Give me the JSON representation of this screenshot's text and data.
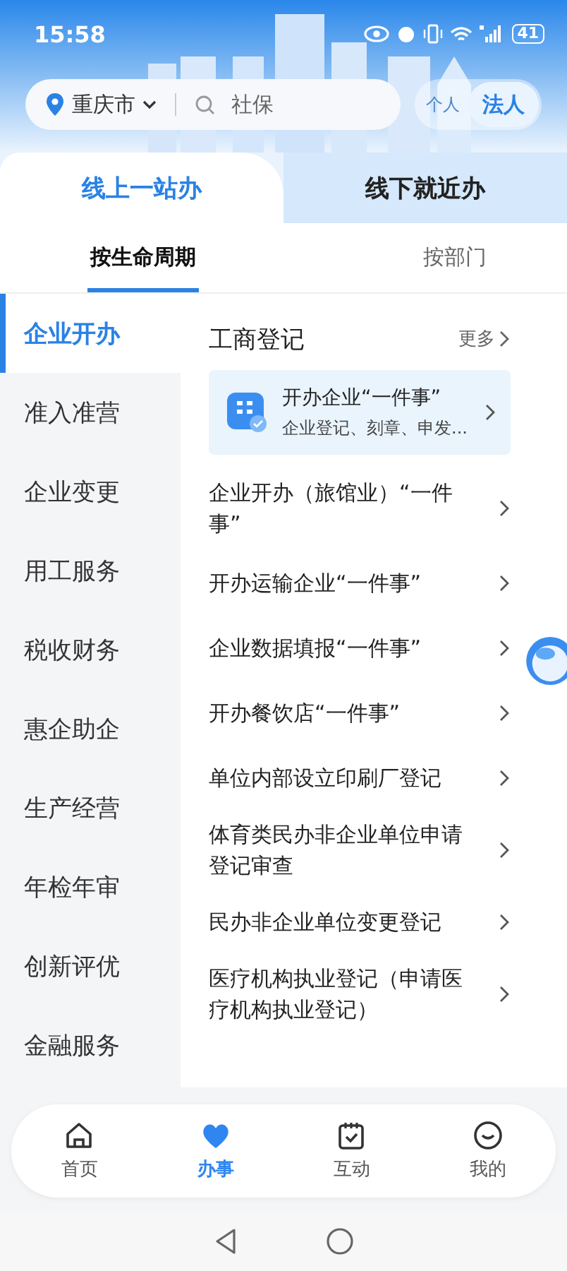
{
  "status_bar": {
    "time": "15:58",
    "battery": "41"
  },
  "search": {
    "city": "重庆市",
    "placeholder": "社保"
  },
  "role_switch": [
    {
      "label": "个人",
      "selected": false
    },
    {
      "label": "法人",
      "selected": true
    }
  ],
  "top_tabs": [
    {
      "label": "线上一站办",
      "selected": true
    },
    {
      "label": "线下就近办",
      "selected": false
    }
  ],
  "sub_tabs": [
    {
      "label": "按生命周期",
      "selected": true
    },
    {
      "label": "按部门",
      "selected": false
    }
  ],
  "sidebar": {
    "items": [
      {
        "label": "企业开办",
        "selected": true
      },
      {
        "label": "准入准营",
        "selected": false
      },
      {
        "label": "企业变更",
        "selected": false
      },
      {
        "label": "用工服务",
        "selected": false
      },
      {
        "label": "税收财务",
        "selected": false
      },
      {
        "label": "惠企助企",
        "selected": false
      },
      {
        "label": "生产经营",
        "selected": false
      },
      {
        "label": "年检年审",
        "selected": false
      },
      {
        "label": "创新评优",
        "selected": false
      },
      {
        "label": "金融服务",
        "selected": false
      }
    ]
  },
  "section": {
    "title": "工商登记",
    "more": "更多",
    "featured": {
      "title": "开办企业“一件事”",
      "subtitle": "企业登记、刻章、申发..."
    },
    "items": [
      "企业开办（旅馆业）“一件事”",
      "开办运输企业“一件事”",
      "企业数据填报“一件事”",
      "开办餐饮店“一件事”",
      "单位内部设立印刷厂登记",
      "体育类民办非企业单位申请登记审查",
      "民办非企业单位变更登记",
      "医疗机构执业登记（申请医疗机构执业登记）"
    ]
  },
  "bottom_nav": [
    {
      "label": "首页",
      "kind": "home",
      "selected": false
    },
    {
      "label": "办事",
      "kind": "heart",
      "selected": true
    },
    {
      "label": "互动",
      "kind": "calendar",
      "selected": false
    },
    {
      "label": "我的",
      "kind": "smile",
      "selected": false
    }
  ]
}
